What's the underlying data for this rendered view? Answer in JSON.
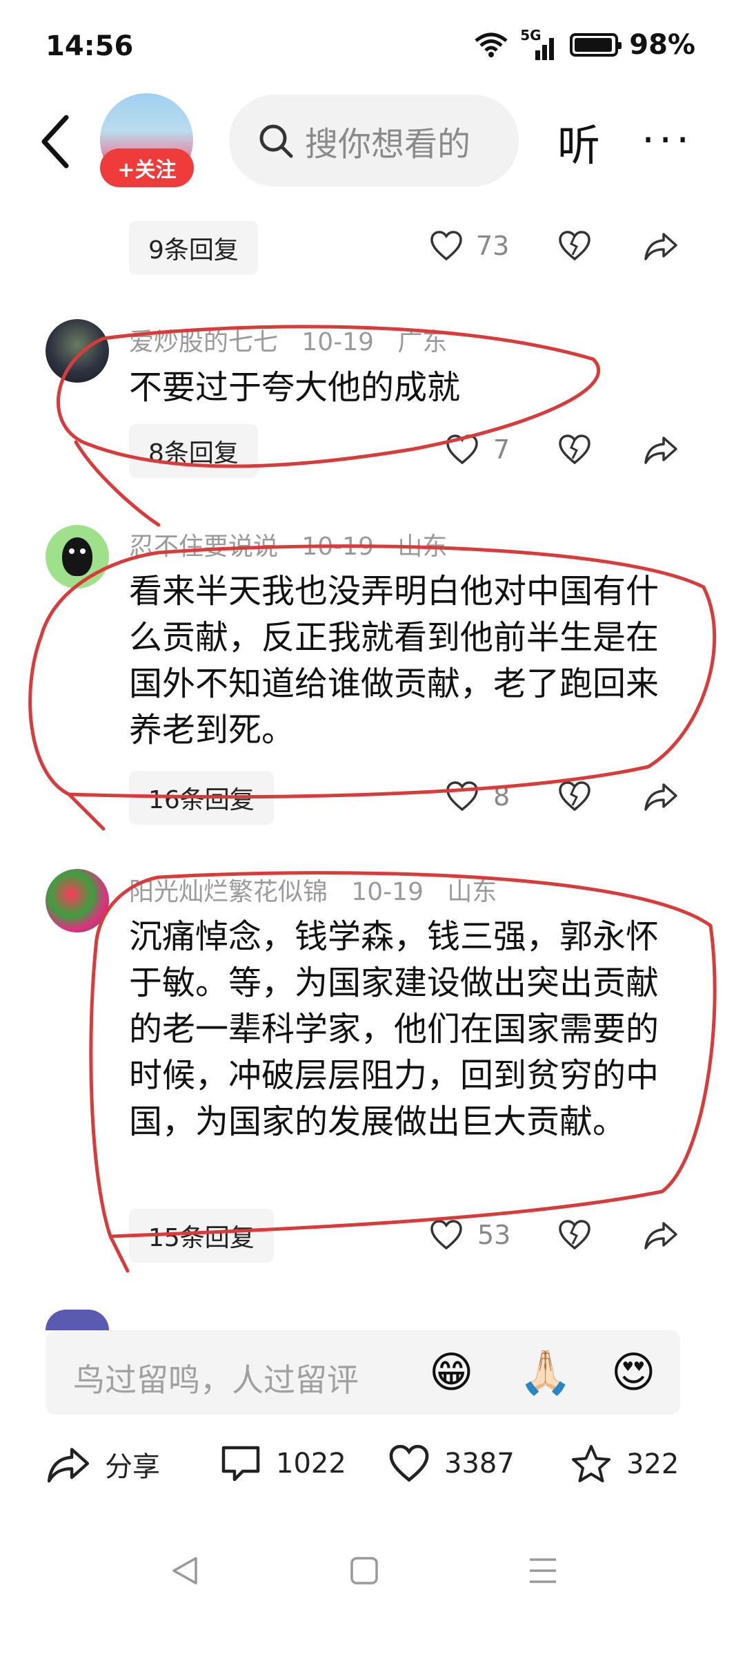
{
  "status": {
    "time": "14:56",
    "network": "5G",
    "battery": "98%"
  },
  "header": {
    "follow_label": "+关注",
    "search_placeholder": "搜你想看的",
    "listen_label": "听",
    "more_label": "···"
  },
  "comments": [
    {
      "reply_count_label": "9条回复",
      "likes": "73"
    },
    {
      "username": "爱炒股的七七",
      "date": "10-19",
      "location": "广东",
      "text": "不要过于夸大他的成就",
      "reply_count_label": "8条回复",
      "likes": "7"
    },
    {
      "username": "忍不住要说说",
      "date": "10-19",
      "location": "山东",
      "text": "看来半天我也没弄明白他对中国有什么贡献，反正我就看到他前半生是在国外不知道给谁做贡献，老了跑回来养老到死。",
      "reply_count_label": "16条回复",
      "likes": "8"
    },
    {
      "username": "阳光灿烂繁花似锦",
      "date": "10-19",
      "location": "山东",
      "text": "沉痛悼念，钱学森，钱三强，郭永怀于敏。等，为国家建设做出突出贡献的老一辈科学家，他们在国家需要的时候，冲破层层阻力，回到贫穷的中国，为国家的发展做出巨大贡献。",
      "reply_count_label": "15条回复",
      "likes": "53"
    }
  ],
  "comment_input": {
    "placeholder": "鸟过留鸣，人过留评",
    "emojis": [
      "😁",
      "🙏🏻",
      "😍"
    ]
  },
  "bottom_bar": {
    "share_label": "分享",
    "comments_count": "1022",
    "likes_count": "3387",
    "favorites_count": "322"
  },
  "colors": {
    "accent_red": "#f03b3b",
    "annotation_red": "#d93a3a",
    "gray_text": "#9a9a9a"
  },
  "icons": [
    "back-arrow-icon",
    "search-icon",
    "heart-icon",
    "broken-heart-icon",
    "share-arrow-icon",
    "comment-icon",
    "star-icon",
    "nav-back-icon",
    "nav-home-icon",
    "nav-menu-icon",
    "wifi-icon",
    "signal-icon",
    "battery-icon"
  ]
}
